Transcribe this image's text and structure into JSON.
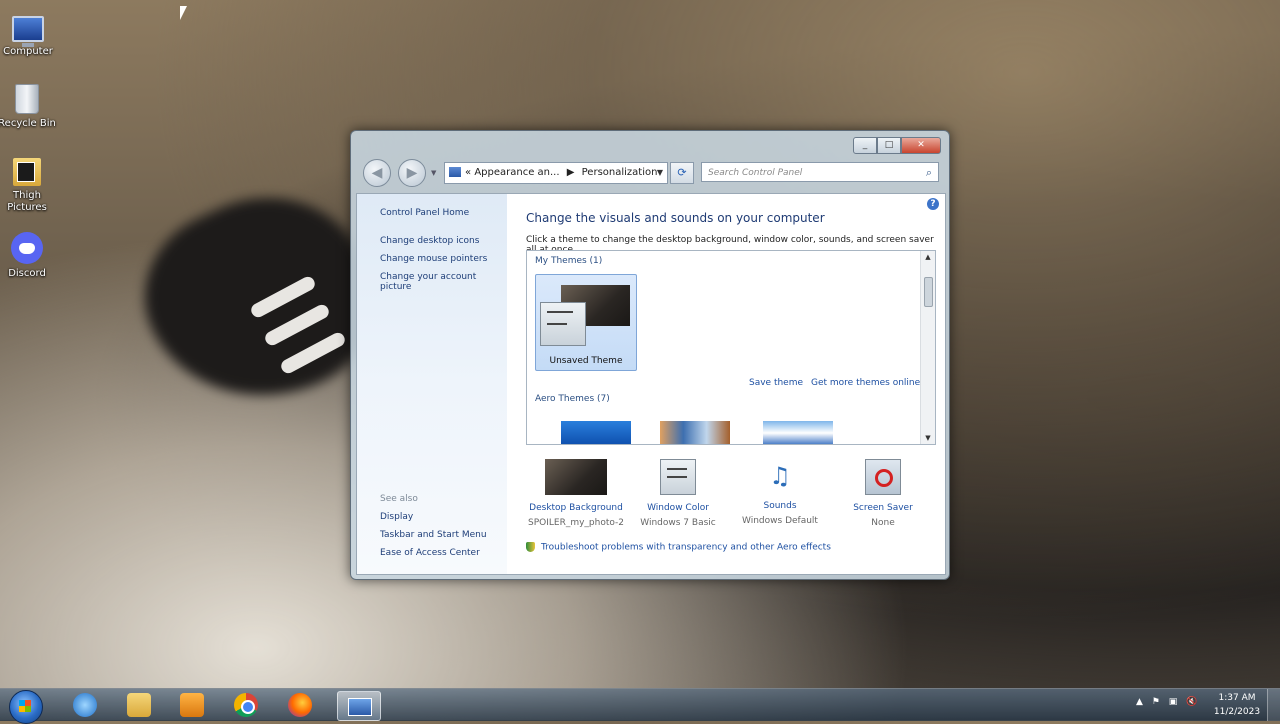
{
  "desktop": {
    "icons": [
      {
        "label": "Computer",
        "icon": "computer-icon"
      },
      {
        "label": "Recycle Bin",
        "icon": "recycle-bin-icon"
      },
      {
        "label": "Thigh Pictures",
        "icon": "folder-icon"
      },
      {
        "label": "Discord",
        "icon": "discord-icon"
      }
    ]
  },
  "window": {
    "address": {
      "part1": "Appearance an...",
      "part2": "Personalization"
    },
    "search_placeholder": "Search Control Panel",
    "left_pane": {
      "home": "Control Panel Home",
      "links": [
        "Change desktop icons",
        "Change mouse pointers",
        "Change your account picture"
      ],
      "see_also_heading": "See also",
      "see_also": [
        "Display",
        "Taskbar and Start Menu",
        "Ease of Access Center"
      ]
    },
    "main": {
      "heading": "Change the visuals and sounds on your computer",
      "subheading": "Click a theme to change the desktop background, window color, sounds, and screen saver all at once.",
      "my_themes_label": "My Themes (1)",
      "selected_theme": "Unsaved Theme",
      "save_theme": "Save theme",
      "get_more": "Get more themes online",
      "aero_themes_label": "Aero Themes (7)",
      "bottom_items": [
        {
          "name": "Desktop Background",
          "value": "SPOILER_my_photo-2"
        },
        {
          "name": "Window Color",
          "value": "Windows 7 Basic"
        },
        {
          "name": "Sounds",
          "value": "Windows Default"
        },
        {
          "name": "Screen Saver",
          "value": "None"
        }
      ],
      "troubleshoot": "Troubleshoot problems with transparency and other Aero effects"
    }
  },
  "taskbar": {
    "time": "1:37 AM",
    "date": "11/2/2023"
  },
  "colors": {
    "link": "#1e50a2",
    "heading": "#1f3b74"
  }
}
